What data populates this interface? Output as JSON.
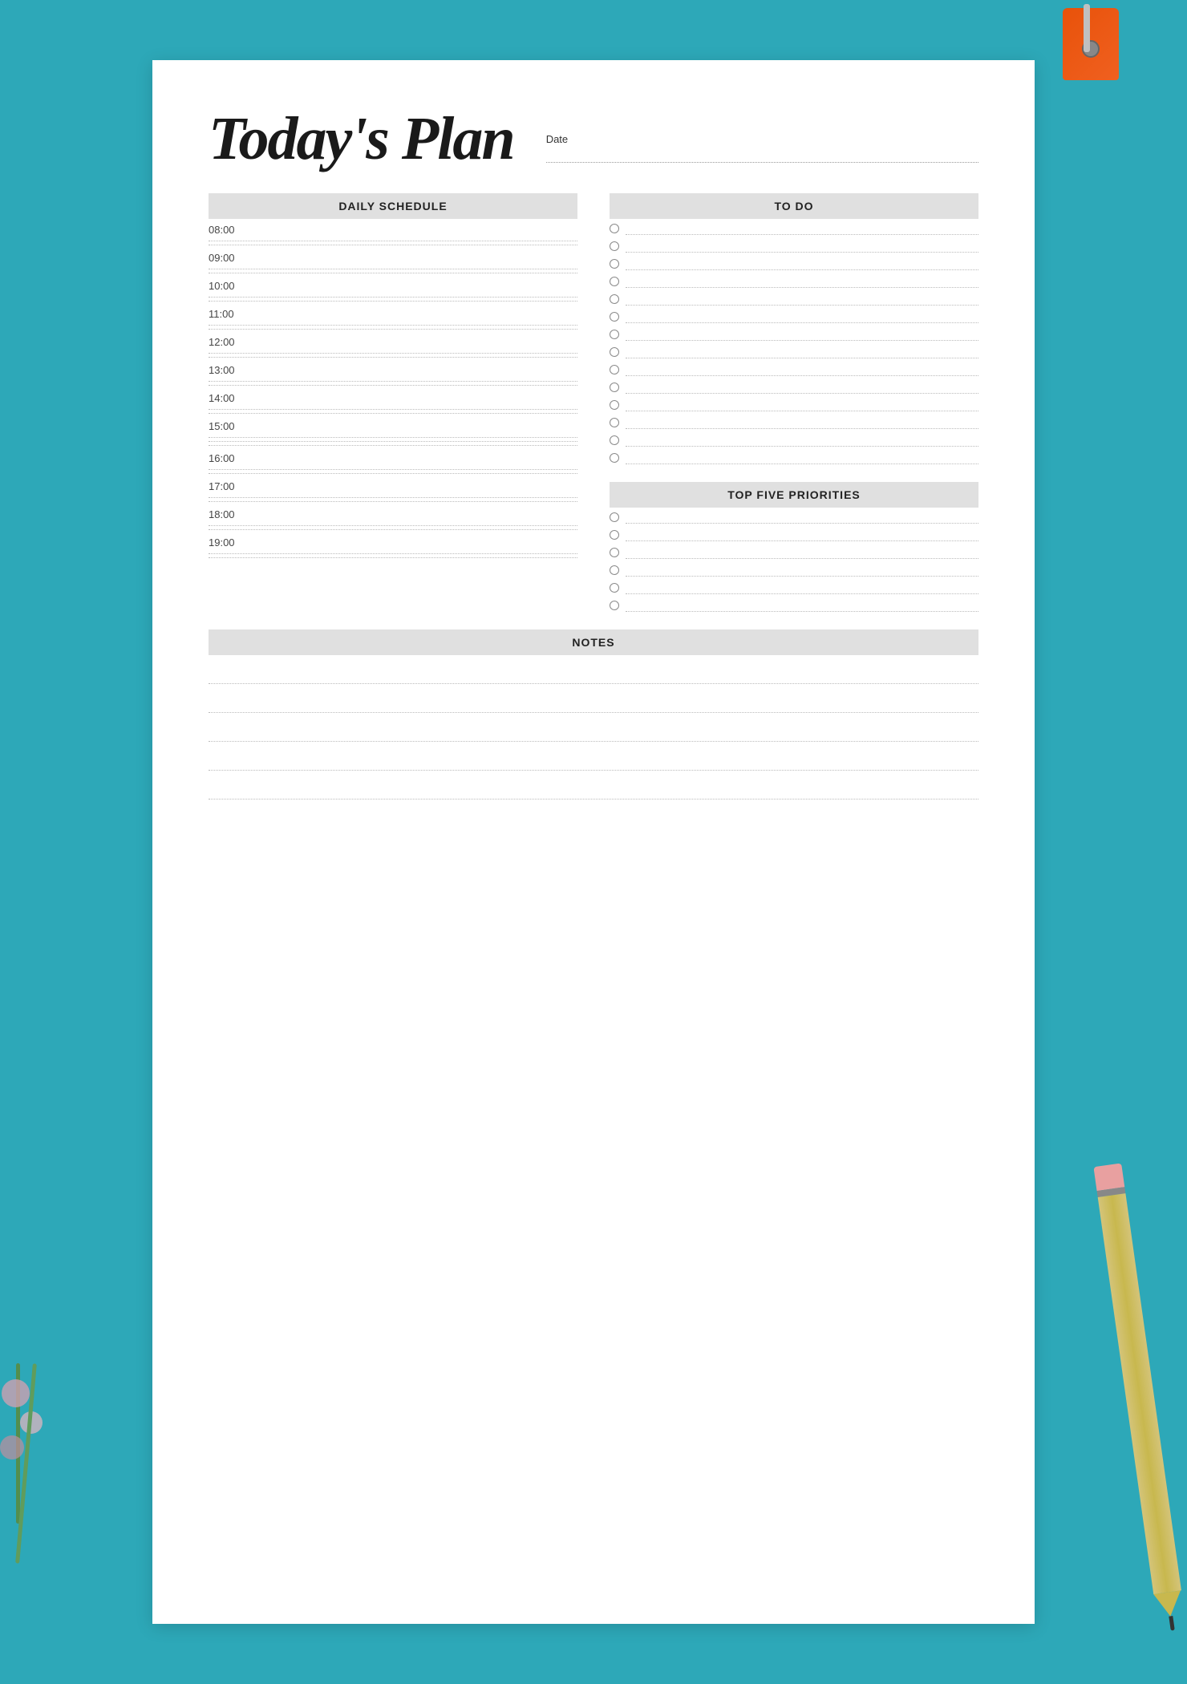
{
  "page": {
    "background_color": "#2da8b8",
    "title": "Today's Plan",
    "date_label": "Date",
    "sections": {
      "daily_schedule": {
        "header": "DAILY SCHEDULE",
        "times": [
          "08:00",
          "09:00",
          "10:00",
          "11:00",
          "12:00",
          "13:00",
          "14:00",
          "15:00",
          "16:00",
          "17:00",
          "18:00",
          "19:00"
        ]
      },
      "todo": {
        "header": "TO DO",
        "items_count": 14
      },
      "top_five_priorities": {
        "header": "TOP FIVE PRIORITIES",
        "items_count": 6
      },
      "notes": {
        "header": "NOTES",
        "lines_count": 5
      }
    }
  }
}
